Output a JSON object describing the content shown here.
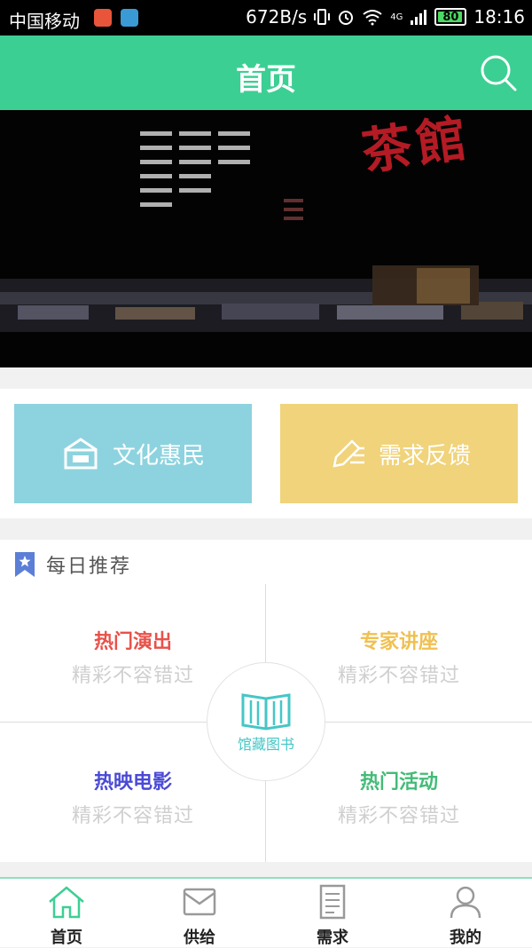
{
  "status_bar": {
    "carrier": "中国移动",
    "net_speed": "672B/s",
    "network": "4G",
    "battery": "80",
    "time": "18:16"
  },
  "header": {
    "title": "首页",
    "search_icon": "search-icon"
  },
  "banner": {
    "text": "茶館"
  },
  "quick_actions": [
    {
      "label": "文化惠民",
      "icon": "house-icon",
      "color": "#8dd3df"
    },
    {
      "label": "需求反馈",
      "icon": "edit-icon",
      "color": "#f0d37b"
    }
  ],
  "recommend": {
    "title": "每日推荐",
    "items": [
      {
        "title": "热门演出",
        "subtitle": "精彩不容错过",
        "color": "#e8514a"
      },
      {
        "title": "专家讲座",
        "subtitle": "精彩不容错过",
        "color": "#f0c050"
      },
      {
        "title": "热映电影",
        "subtitle": "精彩不容错过",
        "color": "#4a4ad6"
      },
      {
        "title": "热门活动",
        "subtitle": "精彩不容错过",
        "color": "#44bb77"
      }
    ],
    "center_label": "馆藏图书"
  },
  "tabs": [
    {
      "label": "首页",
      "icon": "home-icon",
      "active": true
    },
    {
      "label": "供给",
      "icon": "mail-icon",
      "active": false
    },
    {
      "label": "需求",
      "icon": "document-icon",
      "active": false
    },
    {
      "label": "我的",
      "icon": "user-icon",
      "active": false
    }
  ],
  "colors": {
    "primary": "#3ccf93",
    "tab_active": "#3ccf93"
  }
}
